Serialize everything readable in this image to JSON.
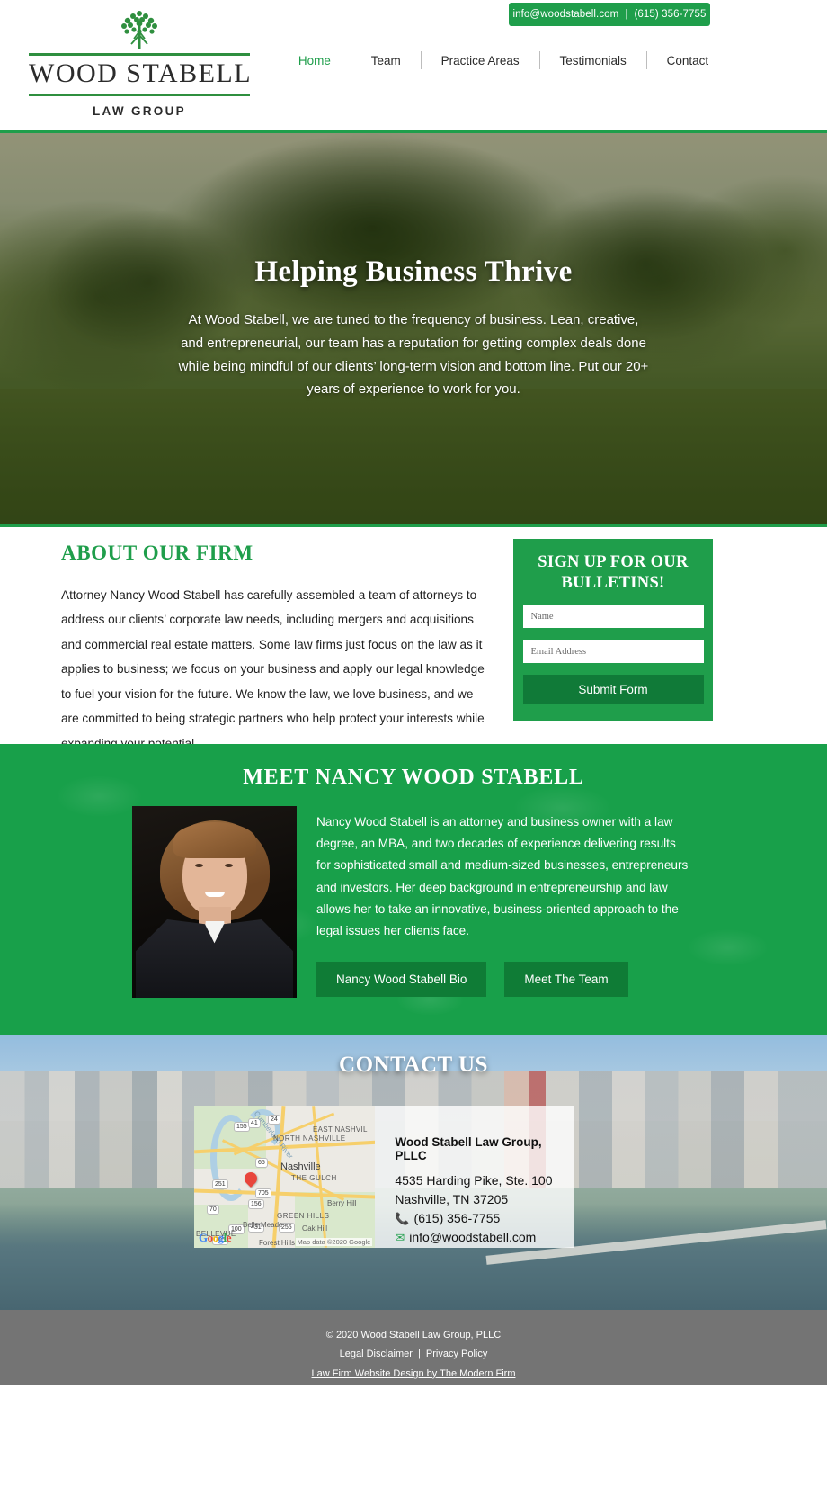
{
  "topbar": {
    "email": "info@woodstabell.com",
    "separator": "|",
    "phone": "(615) 356-7755"
  },
  "logo": {
    "name": "WOOD STABELL",
    "subtitle": "LAW GROUP",
    "icon": "tree-icon"
  },
  "nav": {
    "items": [
      {
        "label": "Home",
        "active": true
      },
      {
        "label": "Team",
        "active": false
      },
      {
        "label": "Practice Areas",
        "active": false
      },
      {
        "label": "Testimonials",
        "active": false
      },
      {
        "label": "Contact",
        "active": false
      }
    ]
  },
  "hero": {
    "title": "Helping Business Thrive",
    "text": "At Wood Stabell, we are tuned to the frequency of business. Lean, creative, and entrepreneurial, our team has a reputation for getting complex deals done while being mindful of our clients’ long-term vision and bottom line. Put our 20+ years of experience to work for you."
  },
  "about": {
    "heading": "ABOUT OUR FIRM",
    "body": "Attorney Nancy Wood Stabell has carefully assembled a team of attorneys to address our clients’ corporate law needs, including mergers and acquisitions and commercial real estate matters. Some law firms just focus on the law as it applies to business; we focus on your business and apply our legal knowledge to fuel your vision for the future. We know the law, we love business, and we are committed to being strategic partners who help protect your interests while expanding your potential."
  },
  "signup": {
    "heading": "SIGN UP FOR OUR BULLETINS!",
    "name_placeholder": "Name",
    "name_value": "",
    "email_placeholder": "Email Address",
    "email_value": "",
    "submit_label": "Submit Form"
  },
  "meet": {
    "heading": "MEET NANCY WOOD STABELL",
    "text": "Nancy Wood Stabell is an attorney and business owner with a law degree, an MBA, and two decades of experience delivering results for sophisticated small and medium-sized businesses, entrepreneurs and investors. Her deep background in entrepreneurship and law allows her to take an innovative, business-oriented approach to the legal issues her clients face.",
    "button_bio": "Nancy Wood Stabell Bio",
    "button_team": "Meet The Team",
    "portrait_alt": "Nancy Wood Stabell portrait"
  },
  "contact": {
    "heading": "CONTACT US",
    "company": "Wood Stabell Law Group, PLLC",
    "address_line1": "4535 Harding Pike, Ste. 100",
    "address_line2": "Nashville, TN 37205",
    "phone": "(615) 356-7755",
    "email": "info@woodstabell.com",
    "map": {
      "credit": "Map data ©2020 Google",
      "brand": "Google",
      "labels": {
        "nashville": "Nashville",
        "gulch": "THE GULCH",
        "north": "NORTH NASHVILLE",
        "east": "EAST NASHVIL",
        "berry": "Berry Hill",
        "green_hills": "GREEN HILLS",
        "belle_meade": "Belle Meade",
        "oak_hill": "Oak Hill",
        "forest_hills": "Forest Hills",
        "bellevue": "BELLEVUE",
        "river": "Cumberland River"
      },
      "shields": [
        "155",
        "41",
        "24",
        "65",
        "705",
        "251",
        "156",
        "70",
        "100",
        "431",
        "255",
        "705"
      ]
    }
  },
  "footer": {
    "copyright": "© 2020 Wood Stabell Law Group, PLLC",
    "legal_disclaimer": "Legal Disclaimer",
    "separator": "|",
    "privacy_policy": "Privacy Policy",
    "design_credit": "Law Firm Website Design by The Modern Firm"
  },
  "colors": {
    "brand_green": "#1f9e4b",
    "dark_green": "#0f7c36",
    "footer_gray": "#747474"
  }
}
